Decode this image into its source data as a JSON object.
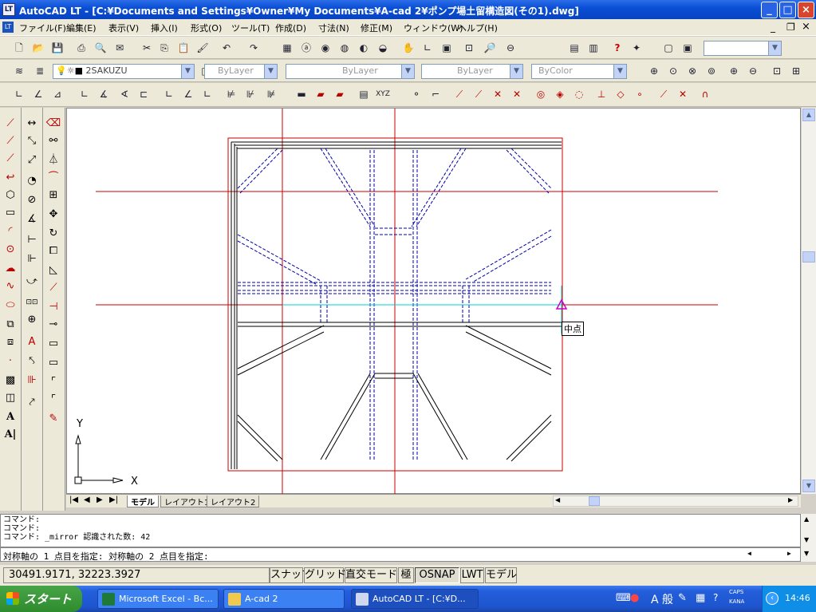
{
  "window": {
    "title": "AutoCAD LT - [C:¥Documents and Settings¥Owner¥My Documents¥A-cad 2¥ポンプ場土留構造図(その1).dwg]",
    "app_icon": "LT"
  },
  "menu": {
    "items": [
      "ファイル(F)",
      "編集(E)",
      "表示(V)",
      "挿入(I)",
      "形式(O)",
      "ツール(T)",
      "作成(D)",
      "寸法(N)",
      "修正(M)",
      "ウィンドウ(W)",
      "ヘルプ(H)"
    ]
  },
  "toolbars": {
    "layer_combo": "2SAKUZU",
    "color_combo": "ByLayer",
    "linetype_combo": "ByLayer",
    "lineweight_combo": "ByLayer",
    "plotstyle_combo": "ByColor"
  },
  "drawing": {
    "snap_tooltip": "中点",
    "ucs_x": "X",
    "ucs_y": "Y"
  },
  "layout_tabs": [
    "モデル",
    "レイアウト1",
    "レイアウト2"
  ],
  "command": {
    "history": [
      "コマンド:",
      "コマンド:",
      "コマンド: _mirror 認識された数: 42"
    ],
    "prompt": "対称軸の 1 点目を指定: 対称軸の 2 点目を指定:"
  },
  "status": {
    "coords": "30491.9171, 32223.3927",
    "buttons": [
      {
        "label": "スナップ",
        "on": false
      },
      {
        "label": "グリッド",
        "on": false
      },
      {
        "label": "直交モード",
        "on": false
      },
      {
        "label": "極",
        "on": false
      },
      {
        "label": "OSNAP",
        "on": true
      },
      {
        "label": "LWT",
        "on": false
      },
      {
        "label": "モデル",
        "on": false
      }
    ]
  },
  "taskbar": {
    "start": "スタート",
    "items": [
      "Microsoft Excel - Bc...",
      "A-cad 2",
      "AutoCAD LT - [C:¥D..."
    ],
    "clock": "14:46",
    "ime": "A 般",
    "caps": "CAPS",
    "kana": "KANA"
  },
  "colors": {
    "construction_line": "#cc0000",
    "entity": "#000000",
    "dashed_entity": "#0000aa",
    "tracking_line": "#00d0d0",
    "snap_marker": "#cc00cc"
  }
}
